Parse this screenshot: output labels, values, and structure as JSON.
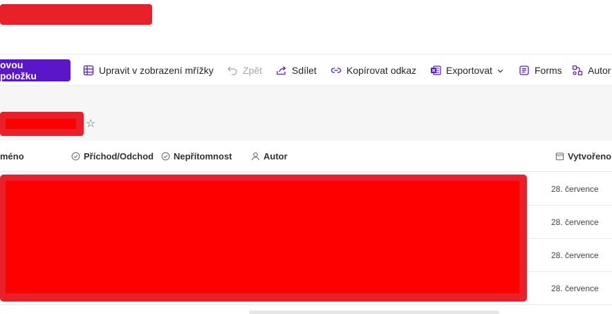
{
  "toolbar": {
    "new_item_label": "ovou položku",
    "edit_grid_label": "Upravit v zobrazení mřížky",
    "undo_label": "Zpět",
    "share_label": "Sdílet",
    "copy_link_label": "Kopírovat odkaz",
    "export_label": "Exportovat",
    "forms_label": "Forms",
    "automate_label": "Autor"
  },
  "table": {
    "columns": [
      {
        "label": "méno"
      },
      {
        "label": "Příchod/Odchod",
        "icon": "check-circle-icon"
      },
      {
        "label": "Nepřítomnost",
        "icon": "check-circle-icon"
      },
      {
        "label": "Autor",
        "icon": "person-icon"
      },
      {
        "label": "Vytvořeno",
        "icon": "calendar-icon"
      }
    ],
    "rows": [
      {
        "created": "28. července"
      },
      {
        "created": "28. července"
      },
      {
        "created": "28. července"
      },
      {
        "created": "28. července"
      }
    ]
  },
  "colors": {
    "accent": "#5b16c9",
    "redaction": "#e8202a",
    "excel_icon": "#1d6f42"
  }
}
